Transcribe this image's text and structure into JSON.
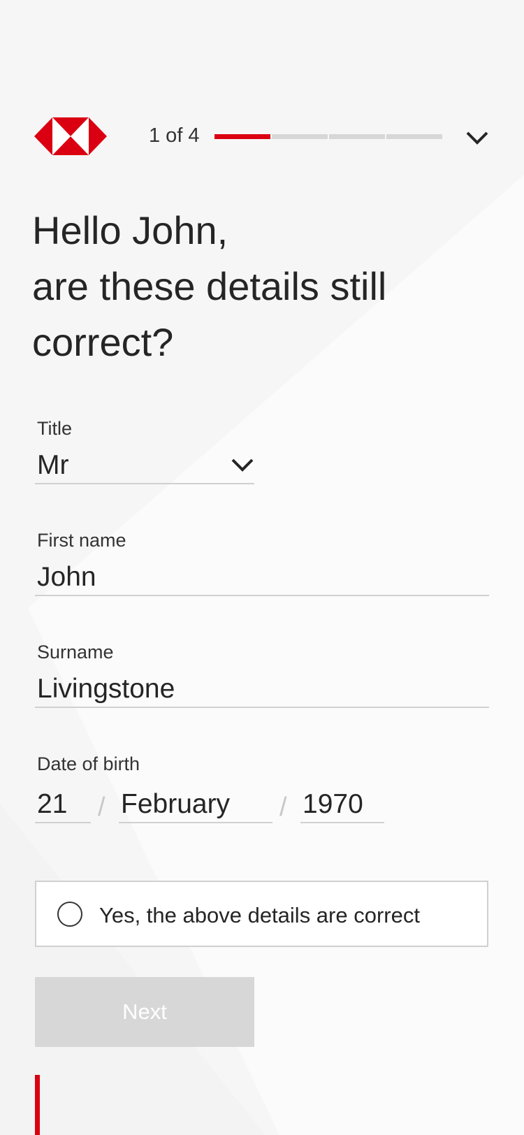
{
  "brand": {
    "logo_icon": "hsbc-hexagon-logo",
    "accent_color": "#DB0011",
    "inactive_color": "#D7D7D7"
  },
  "progress": {
    "label": "1 of 4",
    "current_step": 1,
    "total_steps": 4
  },
  "header": {
    "collapse_icon": "chevron-down-icon"
  },
  "heading": {
    "line1": "Hello John,",
    "line2": "are these details still",
    "line3": "correct?"
  },
  "form": {
    "title": {
      "label": "Title",
      "value": "Mr"
    },
    "first_name": {
      "label": "First name",
      "value": "John"
    },
    "surname": {
      "label": "Surname",
      "value": "Livingstone"
    },
    "date_of_birth": {
      "label": "Date of birth",
      "day": "21",
      "month": "February",
      "year": "1970",
      "separator": "/"
    }
  },
  "confirmation": {
    "label": "Yes, the above details are correct",
    "checked": false
  },
  "actions": {
    "next_label": "Next",
    "next_enabled": false
  }
}
